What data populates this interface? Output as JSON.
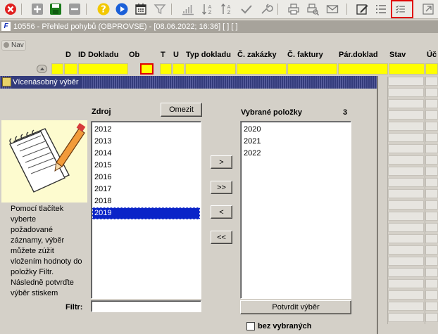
{
  "toolbar": {
    "icons": [
      "close-icon",
      "add-icon",
      "save-icon",
      "remove-icon",
      "help-icon",
      "run-icon",
      "calendar-icon",
      "filter-icon",
      "chart-icon",
      "sort-asc-icon",
      "sort-desc-icon",
      "check-icon",
      "wrench-icon",
      "print-icon",
      "print-preview-icon",
      "mail-icon",
      "edit-icon",
      "list-icon",
      "multi-select-icon",
      "export-icon"
    ],
    "colors": {
      "close": "#e02020",
      "save": "#1a7a1a",
      "help": "#f2c800",
      "run": "#1a5fd8",
      "active_outline": "#e00000"
    }
  },
  "main_window": {
    "title": "10556 - Přehled pohybů (OBPROVSE) - [08.06.2022; 16:36]  [ ]  [ ]",
    "nav_label": "Nav",
    "columns": [
      "D",
      "ID Dokladu",
      "Ob",
      "T",
      "U",
      "Typ dokladu",
      "Č. zakázky",
      "Č. faktury",
      "Pár.doklad",
      "Stav",
      "Úč"
    ]
  },
  "dialog": {
    "title": "Vícenásobný výběr",
    "source_label": "Zdroj",
    "limit_button": "Omezit",
    "selected_label": "Vybrané položky",
    "selected_count": "3",
    "source_items": [
      "2012",
      "2013",
      "2014",
      "2015",
      "2016",
      "2017",
      "2018",
      "2019"
    ],
    "selected_source_item": "2019",
    "selected_items": [
      "2020",
      "2021",
      "2022"
    ],
    "help_lines": [
      "Pomocí tlačítek",
      "vyberte",
      "požadované",
      "záznamy, výběr",
      "můžete zúžit",
      "vložením hodnoty do",
      "položky Filtr.",
      "Následně potvrďte",
      "výběr stiskem"
    ],
    "move_buttons": {
      "add": ">",
      "add_all": ">>",
      "remove": "<",
      "remove_all": "<<"
    },
    "filter_label": "Filtr:",
    "filter_value": "",
    "confirm_button": "Potvrdit výběr",
    "without_selected_label": "bez vybraných",
    "without_selected_checked": false,
    "selection_color": "#0a24c8"
  }
}
